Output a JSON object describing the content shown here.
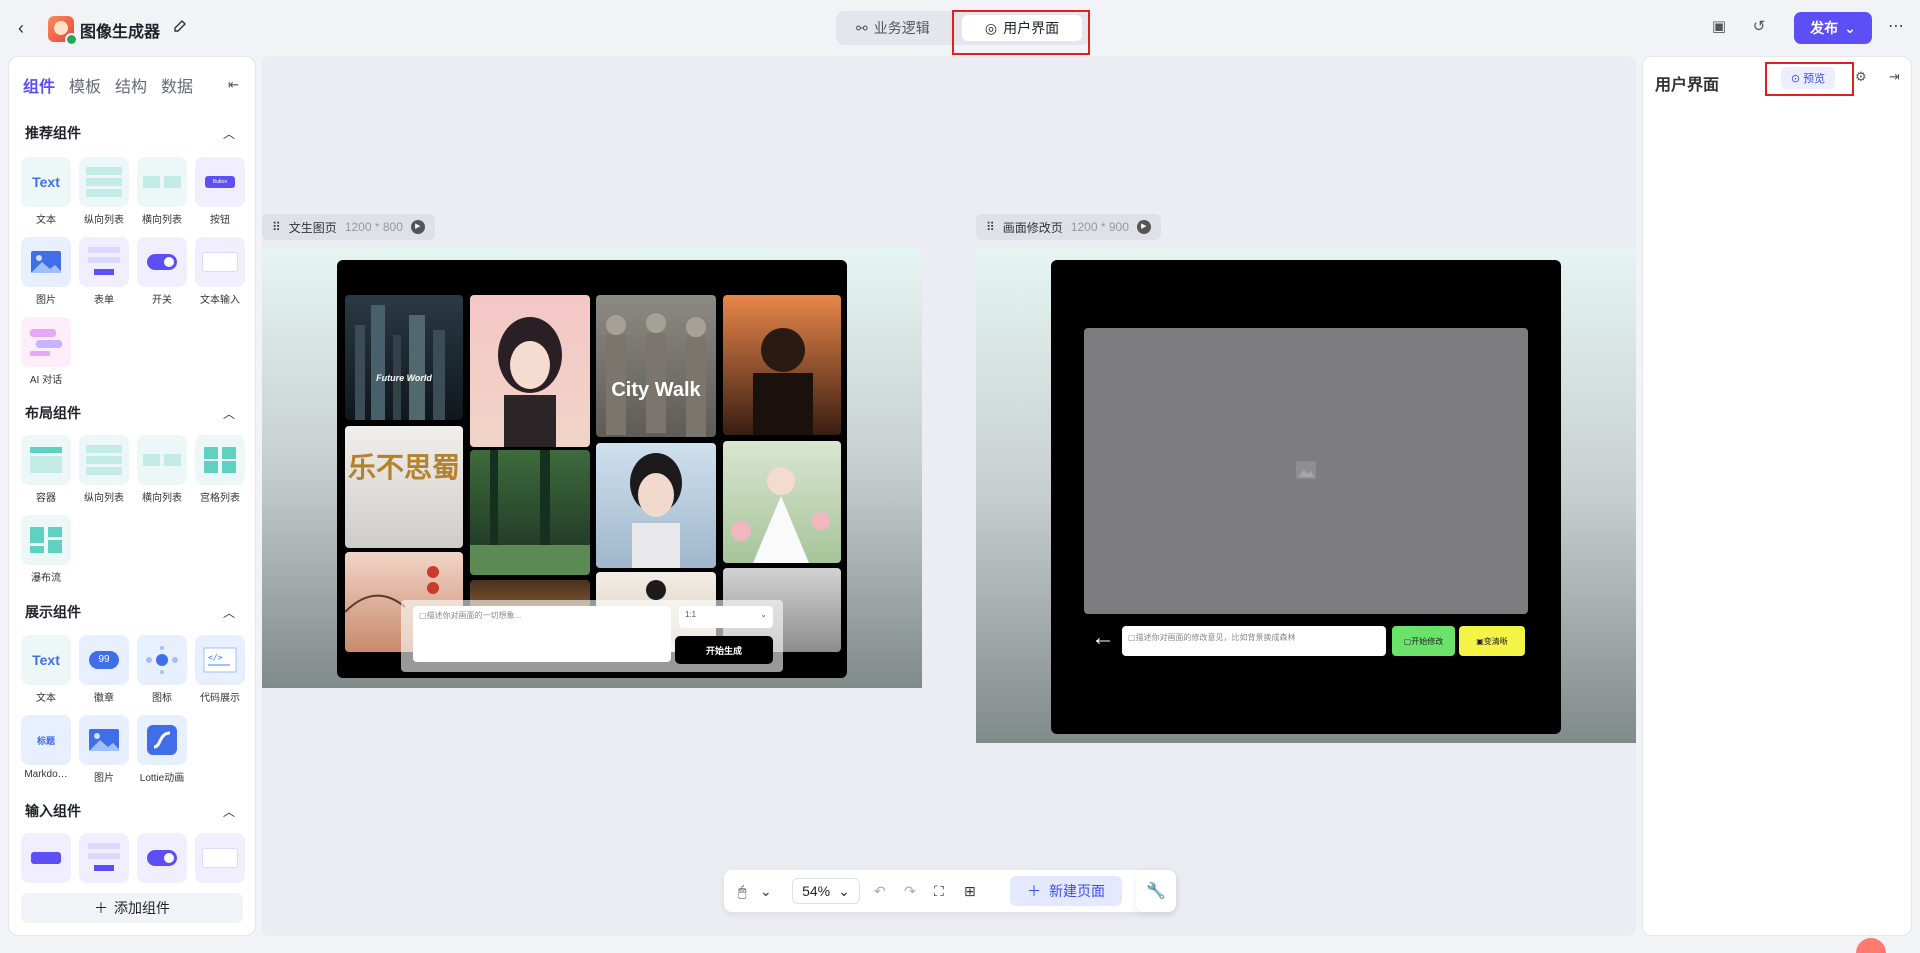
{
  "app": {
    "title": "图像生成器"
  },
  "mode_tabs": [
    {
      "label": "业务逻辑"
    },
    {
      "label": "用户界面"
    }
  ],
  "header": {
    "publish_label": "发布"
  },
  "left_panel": {
    "tabs": [
      "组件",
      "模板",
      "结构",
      "数据"
    ],
    "sections": [
      {
        "title": "推荐组件",
        "items": [
          "文本",
          "纵向列表",
          "横向列表",
          "按钮",
          "图片",
          "表单",
          "开关",
          "文本输入",
          "AI 对话"
        ]
      },
      {
        "title": "布局组件",
        "items": [
          "容器",
          "纵向列表",
          "横向列表",
          "宫格列表",
          "瀑布流"
        ]
      },
      {
        "title": "展示组件",
        "items": [
          "文本",
          "徽章",
          "图标",
          "代码展示",
          "Markdo…",
          "图片",
          "Lottie动画"
        ]
      },
      {
        "title": "输入组件",
        "items": [
          "",
          "",
          "",
          ""
        ]
      }
    ],
    "add_component_label": "添加组件",
    "tile_text": {
      "text_logo": "Text",
      "button_mini": "Button",
      "badge": "99",
      "md": "标题"
    }
  },
  "canvas": {
    "frames": [
      {
        "name": "文生图页",
        "size": "1200 * 800"
      },
      {
        "name": "画面修改页",
        "size": "1200 * 900"
      }
    ],
    "gen_page": {
      "gallery_texts": [
        "Future World",
        "City Walk",
        "乐不思蜀"
      ],
      "prompt_placeholder": "描述你对画面的一切想象...",
      "ratio_value": "1:1",
      "generate_label": "开始生成"
    },
    "edit_page": {
      "input_placeholder": "描述你对画面的修改意见，比如背景换成森林",
      "start_edit_label": "开始修改",
      "clarify_label": "变清晰"
    }
  },
  "toolbar": {
    "zoom": "54%",
    "new_page_label": "新建页面"
  },
  "right_panel": {
    "title": "用户界面",
    "preview_label": "预览"
  }
}
